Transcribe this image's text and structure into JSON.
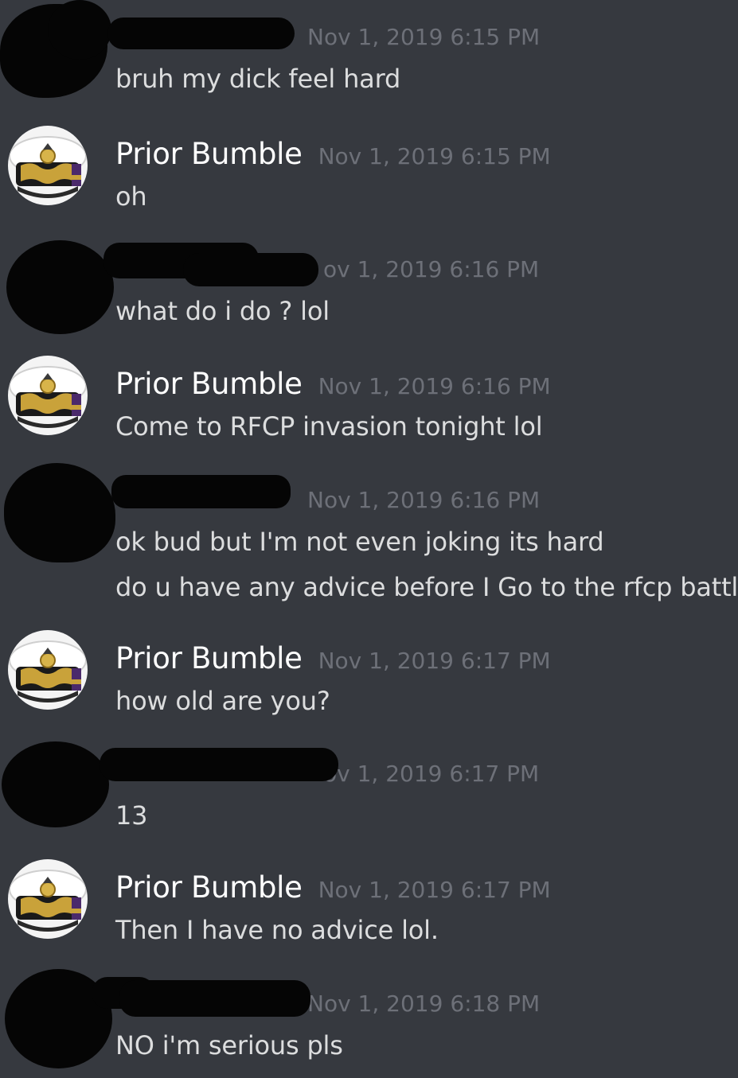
{
  "colors": {
    "background": "#36393f",
    "username": "#ffffff",
    "message_text": "#dcddde",
    "timestamp": "#6d7078",
    "redaction": "#050505"
  },
  "messages": [
    {
      "author": "",
      "author_redacted": true,
      "timestamp": "Nov 1, 2019 6:15 PM",
      "lines": [
        "bruh my dick feel hard"
      ]
    },
    {
      "author": "Prior Bumble",
      "author_redacted": false,
      "avatar_icon": "naval-officer-cap-icon",
      "timestamp": "Nov 1, 2019 6:15 PM",
      "lines": [
        "oh"
      ]
    },
    {
      "author": "",
      "author_redacted": true,
      "timestamp": "ov 1, 2019 6:16 PM",
      "lines": [
        "what do i do ? lol"
      ]
    },
    {
      "author": "Prior Bumble",
      "author_redacted": false,
      "avatar_icon": "naval-officer-cap-icon",
      "timestamp": "Nov 1, 2019 6:16 PM",
      "lines": [
        "Come to RFCP invasion tonight lol"
      ]
    },
    {
      "author": "",
      "author_redacted": true,
      "timestamp": "Nov 1, 2019 6:16 PM",
      "lines": [
        "ok bud but I'm not even joking its hard",
        "do u have any advice before I Go to the rfcp battle"
      ]
    },
    {
      "author": "Prior Bumble",
      "author_redacted": false,
      "avatar_icon": "naval-officer-cap-icon",
      "timestamp": "Nov 1, 2019 6:17 PM",
      "lines": [
        "how old are you?"
      ]
    },
    {
      "author": "",
      "author_redacted": true,
      "timestamp": "ov 1, 2019 6:17 PM",
      "lines": [
        "13"
      ]
    },
    {
      "author": "Prior Bumble",
      "author_redacted": false,
      "avatar_icon": "naval-officer-cap-icon",
      "timestamp": "Nov 1, 2019 6:17 PM",
      "lines": [
        "Then I have no advice lol."
      ]
    },
    {
      "author": "",
      "author_redacted": true,
      "timestamp": "Nov 1, 2019 6:18 PM",
      "lines": [
        "NO i'm serious pls"
      ]
    }
  ]
}
